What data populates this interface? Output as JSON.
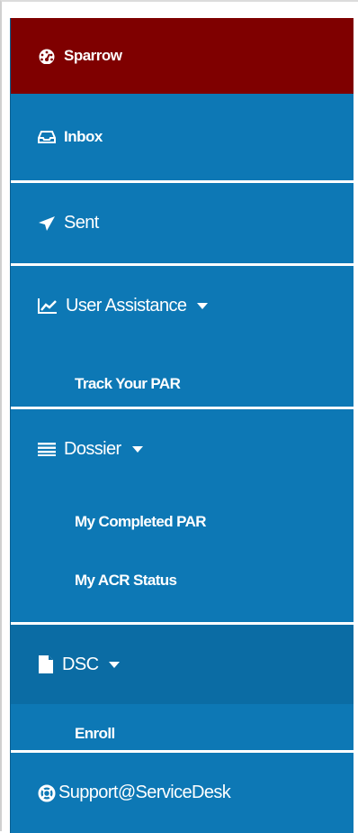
{
  "nav": {
    "brand": {
      "label": "Sparrow",
      "icon": "dashboard-icon"
    },
    "inbox": {
      "label": "Inbox",
      "icon": "inbox-icon"
    },
    "sent": {
      "label": "Sent",
      "icon": "send-icon"
    },
    "user_assistance": {
      "label": "User Assistance",
      "icon": "line-chart-icon",
      "children": [
        {
          "label": "Track Your PAR"
        }
      ]
    },
    "dossier": {
      "label": "Dossier",
      "icon": "list-icon",
      "children": [
        {
          "label": "My Completed PAR"
        },
        {
          "label": "My ACR Status"
        }
      ]
    },
    "dsc": {
      "label": "DSC",
      "icon": "file-icon",
      "children": [
        {
          "label": "Enroll"
        }
      ]
    },
    "support": {
      "label": "Support@ServiceDesk",
      "icon": "lifebuoy-icon"
    }
  },
  "colors": {
    "brand_bg": "#7f0000",
    "sidebar_bg": "#0d78b5",
    "active_group_bg": "#0b6ca4",
    "text": "#ffffff"
  }
}
